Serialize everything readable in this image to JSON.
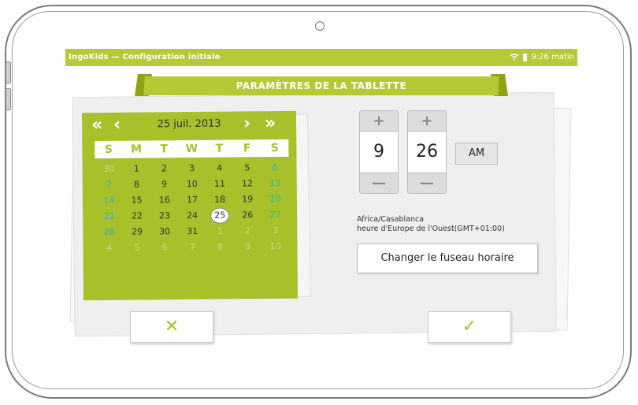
{
  "statusbar": {
    "title": "IngoKids — Configuration initiale",
    "time": "9:26 matin"
  },
  "banner": {
    "title": "PARAMÈTRES DE LA TABLETTE"
  },
  "calendar": {
    "month_label": "25 juil. 2013",
    "prev_year": "«",
    "prev_month": "‹",
    "next_month": "›",
    "next_year": "»",
    "weekdays": [
      "S",
      "M",
      "T",
      "W",
      "T",
      "F",
      "S"
    ],
    "weeks": [
      [
        "30",
        "1",
        "2",
        "3",
        "4",
        "5",
        "6"
      ],
      [
        "7",
        "8",
        "9",
        "10",
        "11",
        "12",
        "13"
      ],
      [
        "14",
        "15",
        "16",
        "17",
        "18",
        "19",
        "20"
      ],
      [
        "21",
        "22",
        "23",
        "24",
        "25",
        "26",
        "27"
      ],
      [
        "28",
        "29",
        "30",
        "31",
        "1",
        "2",
        "3"
      ],
      [
        "4",
        "5",
        "6",
        "7",
        "8",
        "9",
        "10"
      ]
    ],
    "selected_day": "25"
  },
  "time_picker": {
    "hour": "9",
    "minute": "26",
    "ampm": "AM",
    "plus": "+",
    "minus": "—"
  },
  "timezone": {
    "zone": "Africa/Casablanca",
    "description": "heure d'Europe de l'Ouest(GMT+01:00)",
    "change_button": "Changer le fuseau horaire"
  },
  "actions": {
    "cancel_symbol": "✕",
    "confirm_symbol": "✓"
  },
  "colors": {
    "accent": "#b7c93a",
    "calendar": "#a8c02a",
    "weekend": "#27b6c8"
  }
}
